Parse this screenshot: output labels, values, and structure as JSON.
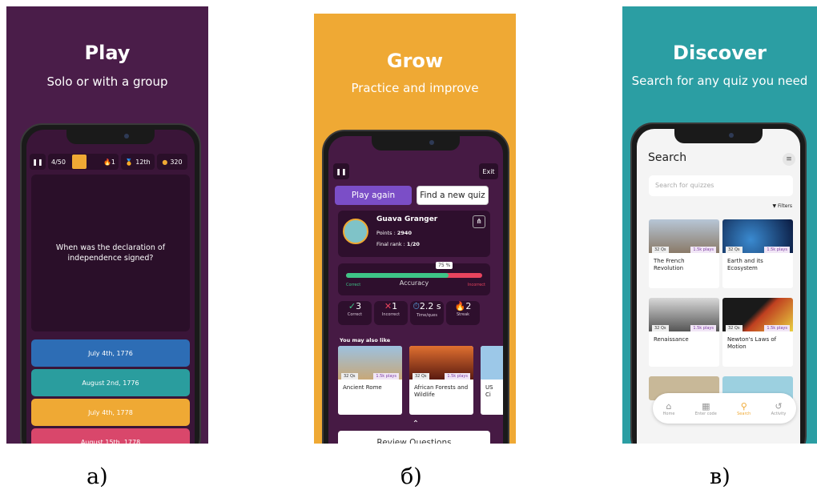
{
  "play": {
    "title": "Play",
    "subtitle": "Solo or with a group",
    "progress": "4/50",
    "streak": "1",
    "rank": "12th",
    "coins": "320",
    "question": "When was the declaration of independence signed?",
    "answers": [
      {
        "label": "July 4th, 1776",
        "color": "#2d6db5"
      },
      {
        "label": "August 2nd, 1776",
        "color": "#2a9d9e"
      },
      {
        "label": "July 4th, 1778",
        "color": "#efa934"
      },
      {
        "label": "August 15th, 1778",
        "color": "#d9476b"
      }
    ]
  },
  "grow": {
    "title": "Grow",
    "subtitle": "Practice and improve",
    "exit_label": "Exit",
    "play_again_label": "Play again",
    "find_quiz_label": "Find a new quiz",
    "player_name": "Guava Granger",
    "points_label": "Points :",
    "points_value": "2940",
    "rank_label": "Final rank :",
    "rank_value": "1/20",
    "accuracy_percent": "75 %",
    "accuracy_fraction": 0.75,
    "accuracy_label": "Accuracy",
    "correct_label": "Correct",
    "incorrect_label": "Incorrect",
    "stats": [
      {
        "icon": "✓",
        "value": "3",
        "label": "Correct",
        "color": "#3ec487"
      },
      {
        "icon": "✕",
        "value": "1",
        "label": "Incorrect",
        "color": "#e8445e"
      },
      {
        "icon": "⏱",
        "value": "2.2 s",
        "label": "Time/ques",
        "color": "#5aa8e8"
      },
      {
        "icon": "🔥",
        "value": "2",
        "label": "Streak",
        "color": "#f0a030"
      }
    ],
    "also_like_label": "You may also like",
    "suggestions": [
      {
        "name": "Ancient Rome",
        "qs": "32 Qs",
        "plays": "1.5k plays"
      },
      {
        "name": "African Forests and Wildlife",
        "qs": "32 Qs",
        "plays": "1.5k plays"
      },
      {
        "name": "US Ci",
        "qs": "",
        "plays": ""
      }
    ],
    "review_label": "Review Questions"
  },
  "discover": {
    "title": "Discover",
    "subtitle": "Search for any quiz you need",
    "search_title": "Search",
    "search_placeholder": "Search for quizzes",
    "filters_label": "Filters",
    "tiles": [
      {
        "name": "The French Revolution",
        "qs": "32 Qs",
        "plays": "1.5k plays"
      },
      {
        "name": "Earth and its Ecosystem",
        "qs": "32 Qs",
        "plays": "1.5k plays"
      },
      {
        "name": "Renaissance",
        "qs": "32 Qs",
        "plays": "1.5k plays"
      },
      {
        "name": "Newton's Laws of Motion",
        "qs": "32 Qs",
        "plays": "1.5k plays"
      }
    ],
    "nav": [
      {
        "label": "Home",
        "icon": "home-icon"
      },
      {
        "label": "Enter code",
        "icon": "keypad-icon"
      },
      {
        "label": "Search",
        "icon": "search-icon"
      },
      {
        "label": "Activity",
        "icon": "history-icon"
      }
    ]
  },
  "captions": [
    "а)",
    "б)",
    "в)"
  ]
}
